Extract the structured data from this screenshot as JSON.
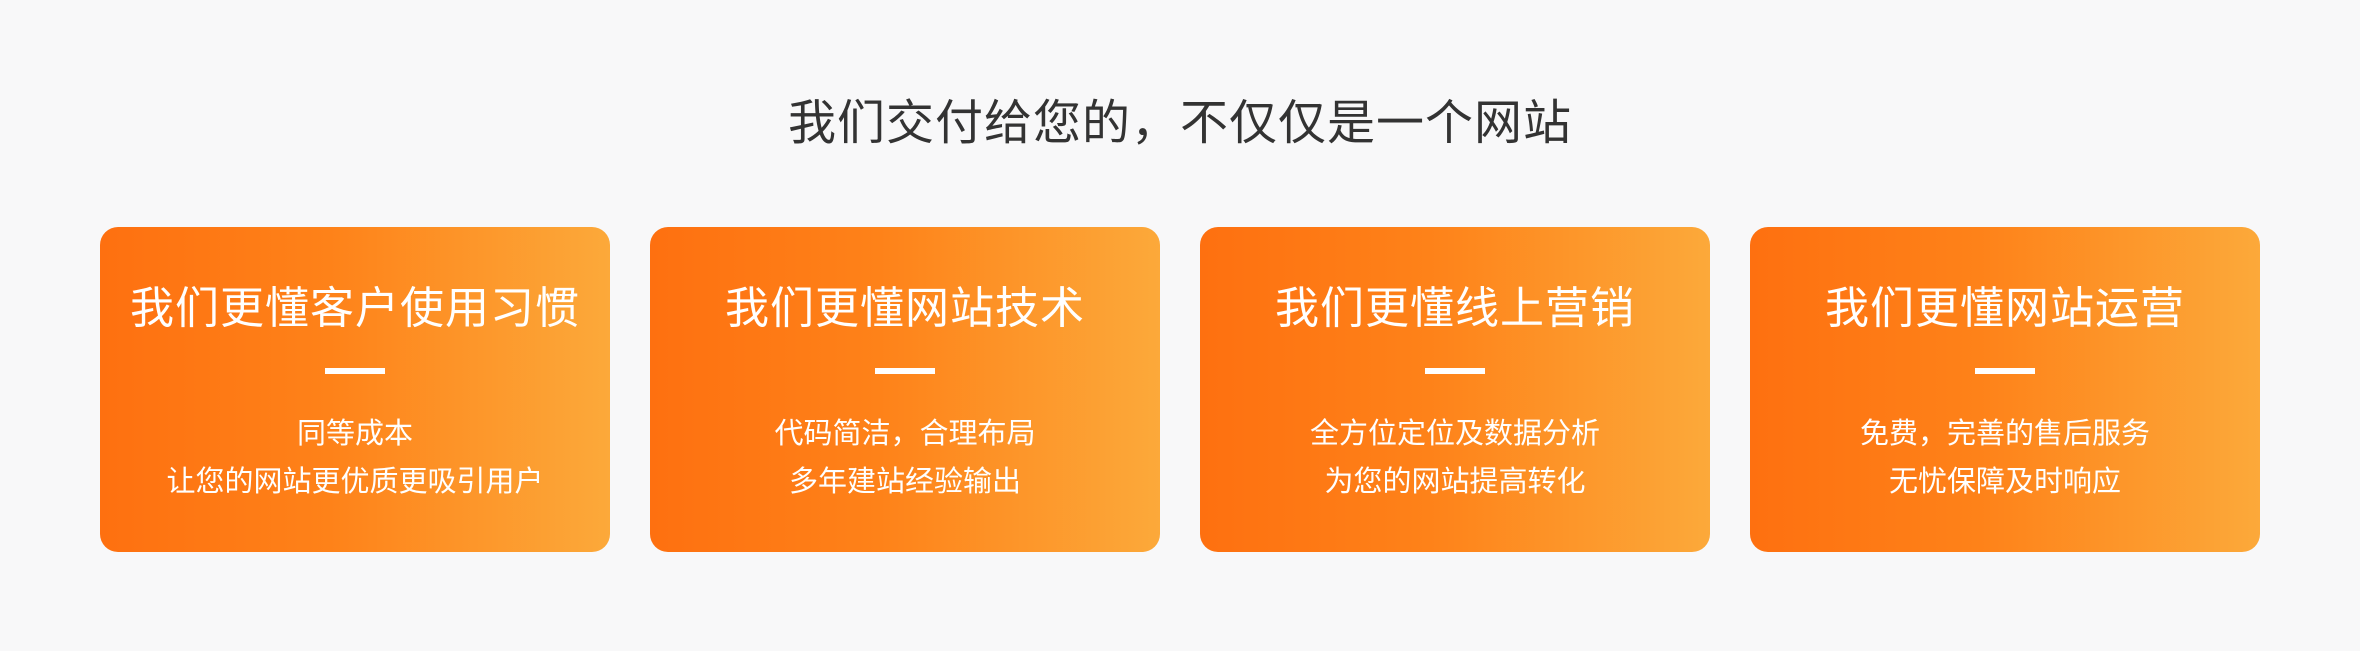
{
  "section": {
    "title": "我们交付给您的，不仅仅是一个网站"
  },
  "cards": [
    {
      "title": "我们更懂客户使用习惯",
      "lines": [
        "同等成本",
        "让您的网站更优质更吸引用户"
      ]
    },
    {
      "title": "我们更懂网站技术",
      "lines": [
        "代码简洁，合理布局",
        "多年建站经验输出"
      ]
    },
    {
      "title": "我们更懂线上营销",
      "lines": [
        "全方位定位及数据分析",
        "为您的网站提高转化"
      ]
    },
    {
      "title": "我们更懂网站运营",
      "lines": [
        "免费，完善的售后服务",
        "无忧保障及时响应"
      ]
    }
  ],
  "colors": {
    "background": "#f8f8f9",
    "title_text": "#333333",
    "card_gradient_start": "#fe7010",
    "card_gradient_end": "#fca93a",
    "card_text": "#ffffff"
  }
}
